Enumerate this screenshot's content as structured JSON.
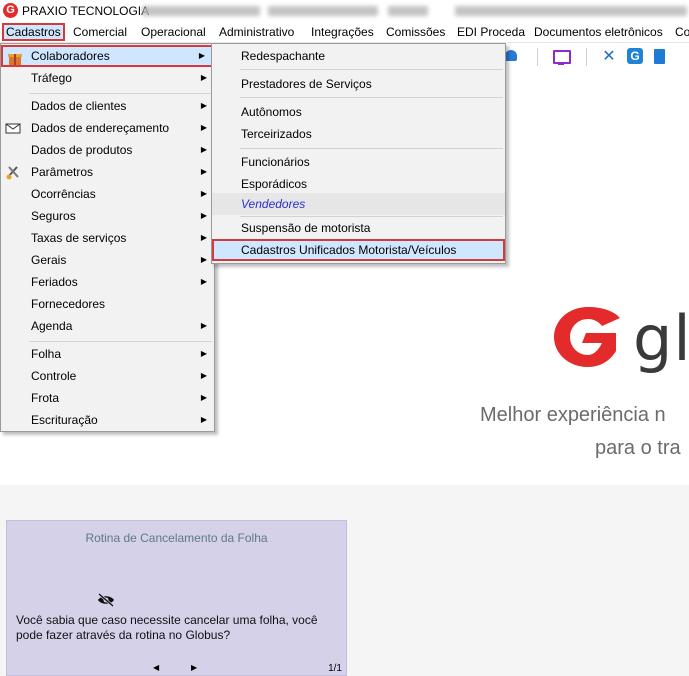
{
  "window": {
    "title": "PRAXIO TECNOLOGIA"
  },
  "menubar": {
    "items": [
      "Cadastros",
      "Comercial",
      "Operacional",
      "Administrativo",
      "Integrações",
      "Comissões",
      "EDI Proceda",
      "Documentos eletrônicos",
      "Co"
    ]
  },
  "cadastros_menu": {
    "items": [
      {
        "label": "Colaboradores",
        "submenu": true,
        "icon": "people-gift-icon"
      },
      {
        "label": "Tráfego",
        "submenu": true
      },
      {
        "label": "Dados de clientes",
        "submenu": true
      },
      {
        "label": "Dados de endereçamento",
        "submenu": true,
        "icon": "envelope-icon"
      },
      {
        "label": "Dados de produtos",
        "submenu": true
      },
      {
        "label": "Parâmetros",
        "submenu": true,
        "icon": "settings-tools-icon"
      },
      {
        "label": "Ocorrências",
        "submenu": true
      },
      {
        "label": "Seguros",
        "submenu": true
      },
      {
        "label": "Taxas de serviços",
        "submenu": true
      },
      {
        "label": "Gerais",
        "submenu": true
      },
      {
        "label": "Feriados",
        "submenu": true
      },
      {
        "label": "Fornecedores",
        "submenu": false
      },
      {
        "label": "Agenda",
        "submenu": true
      },
      {
        "label": "Folha",
        "submenu": true
      },
      {
        "label": "Controle",
        "submenu": true
      },
      {
        "label": "Frota",
        "submenu": true
      },
      {
        "label": "Escrituração",
        "submenu": true
      }
    ]
  },
  "colaboradores_submenu": {
    "items": [
      {
        "label": "Redespachante"
      },
      {
        "label": "Prestadores de Serviços"
      },
      {
        "label": "Autônomos"
      },
      {
        "label": "Terceirizados"
      },
      {
        "label": "Funcionários"
      },
      {
        "label": "Esporádicos"
      },
      {
        "label": "Vendedores"
      },
      {
        "label": "Suspensão de motorista"
      },
      {
        "label": "Cadastros Unificados Motorista/Veículos"
      }
    ]
  },
  "brand": {
    "name_partial": "gl",
    "tagline_line1": "Melhor experiência n",
    "tagline_line2": "para o tra",
    "accent_color": "#e32b2b"
  },
  "tip_card": {
    "title": "Rotina de Cancelamento da Folha",
    "text": "Você sabia que caso necessite cancelar uma folha, você pode fazer através da rotina no Globus?",
    "page": "1/1",
    "prev": "◀",
    "next": "▶"
  },
  "toolbar": {
    "icons": [
      "bell-icon",
      "monitor-icon",
      "tools-icon",
      "globus-g-icon",
      "document-icon"
    ]
  }
}
